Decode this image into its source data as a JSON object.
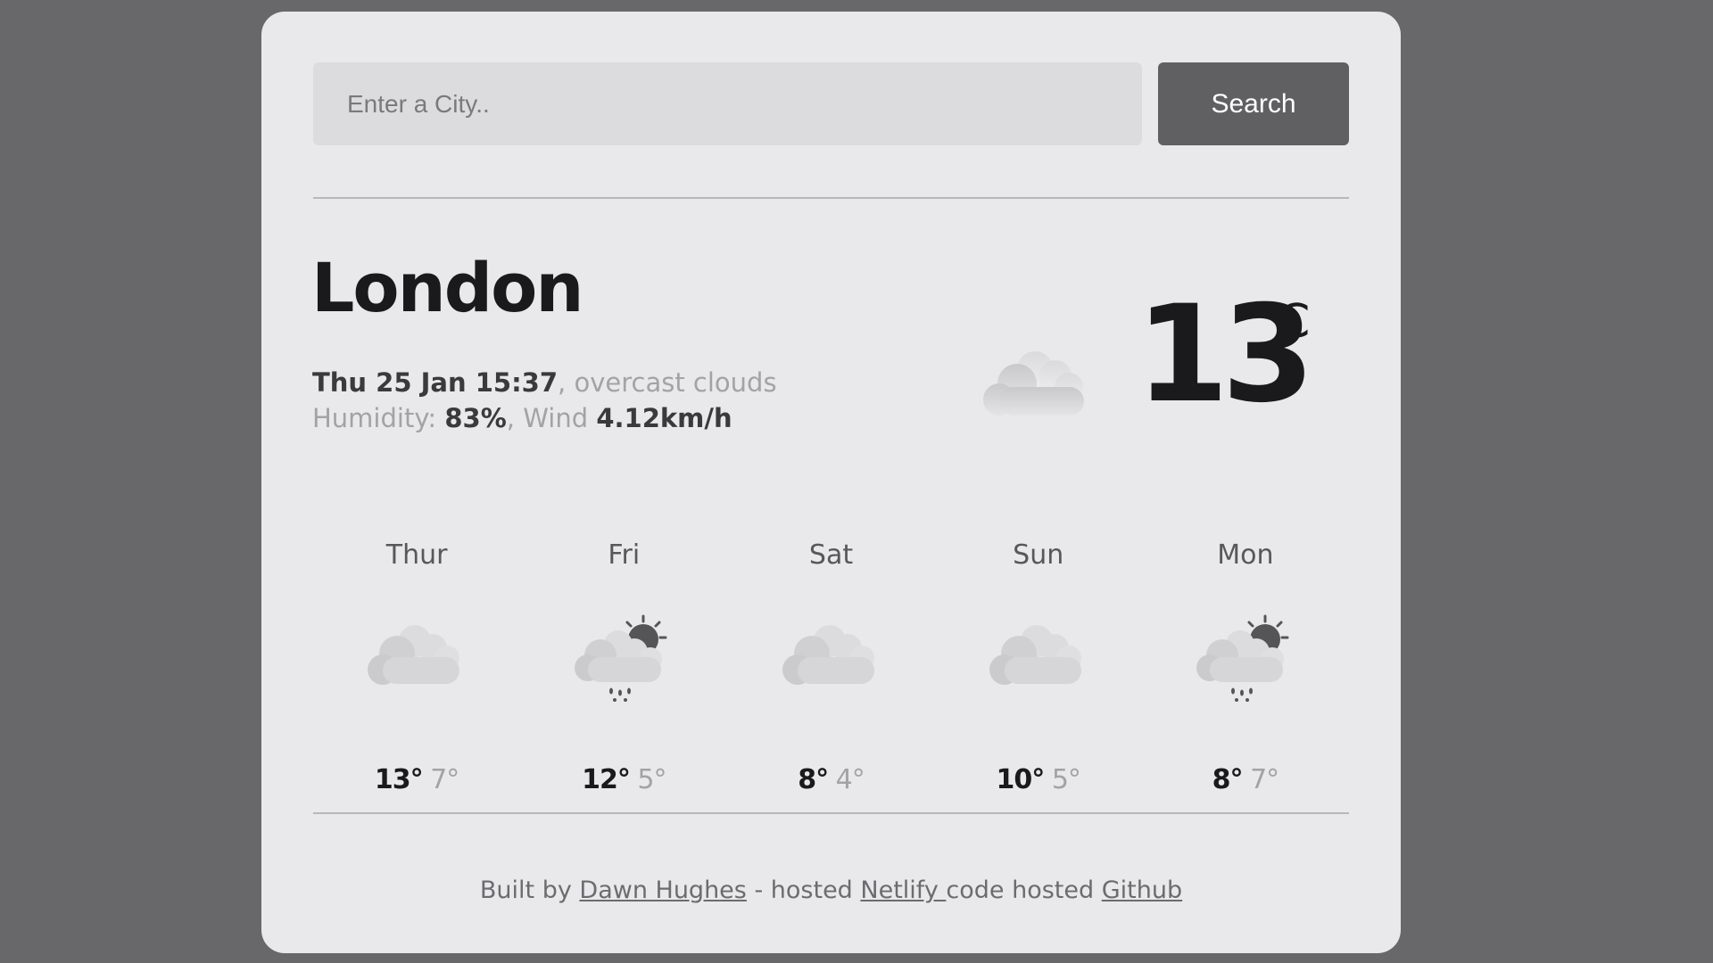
{
  "search": {
    "placeholder": "Enter a City..",
    "button_label": "Search"
  },
  "current": {
    "city": "London",
    "datetime": "Thu 25 Jan 15:37",
    "description": ", overcast clouds",
    "humidity_label": "Humidity: ",
    "humidity_value": "83%",
    "wind_label": ", Wind ",
    "wind_value": "4.12km/h",
    "icon": "overcast-clouds-icon",
    "temperature": "13",
    "unit": "°C"
  },
  "forecast": [
    {
      "day": "Thur",
      "high": "13°",
      "low": "7°",
      "icon": "overcast-clouds-icon"
    },
    {
      "day": "Fri",
      "high": "12°",
      "low": "5°",
      "icon": "sun-cloud-rain-icon"
    },
    {
      "day": "Sat",
      "high": "8°",
      "low": "4°",
      "icon": "overcast-clouds-icon"
    },
    {
      "day": "Sun",
      "high": "10°",
      "low": "5°",
      "icon": "overcast-clouds-icon"
    },
    {
      "day": "Mon",
      "high": "8°",
      "low": "7°",
      "icon": "sun-cloud-rain-icon"
    }
  ],
  "footer": {
    "built_by": "Built by ",
    "author": "Dawn Hughes",
    "hosted_text": " - hosted ",
    "netlify": "Netlify ",
    "code_text": "code hosted ",
    "github": "Github"
  },
  "colors": {
    "background": "#68686b",
    "card": "#e9e9eb",
    "button": "#606063",
    "input": "#dcdcde"
  }
}
